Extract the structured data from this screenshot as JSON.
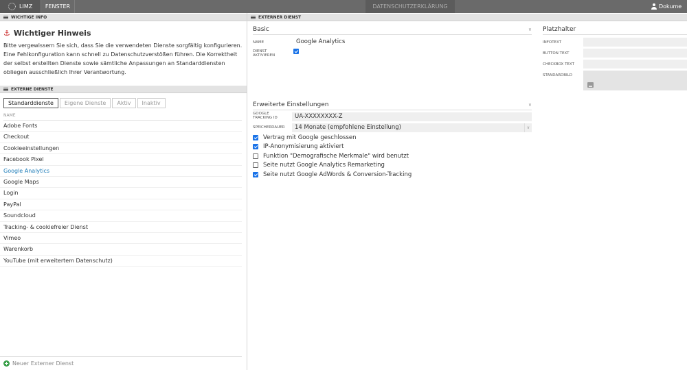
{
  "topbar": {
    "brand": "LIMZ",
    "window_menu": "FENSTER",
    "window_title": "DATENSCHUTZERKLÄRUNG",
    "user": "Dokume"
  },
  "left": {
    "info_header": "WICHTIGE INFO",
    "hint_title": "Wichtiger Hinweis",
    "hint_text": "Bitte vergewissern Sie sich, dass Sie die verwendeten Dienste sorgfältig konfigurieren. Eine Fehlkonfiguration kann schnell zu Datenschutzverstößen führen. Die Korrektheit der selbst erstellten Dienste sowie sämtliche Anpassungen an Standarddiensten obliegen ausschließlich Ihrer Verantwortung.",
    "services_header": "EXTERNE DIENSTE",
    "tabs": [
      "Standarddienste",
      "Eigene Dienste",
      "Aktiv",
      "Inaktiv"
    ],
    "list_header": "NAME",
    "services": [
      "Adobe Fonts",
      "Checkout",
      "Cookieeinstellungen",
      "Facebook Pixel",
      "Google Analytics",
      "Google Maps",
      "Login",
      "PayPal",
      "Soundcloud",
      "Tracking- & cookiefreier Dienst",
      "Vimeo",
      "Warenkorb",
      "YouTube (mit erweitertem Datenschutz)"
    ],
    "selected_service": "Google Analytics",
    "new_service": "Neuer Externer Dienst"
  },
  "right": {
    "header": "EXTERNER DIENST",
    "basic": {
      "title": "Basic",
      "name_label": "NAME",
      "name_value": "Google Analytics",
      "active_label_1": "DIENST",
      "active_label_2": "AKTIVIEREN",
      "active": true
    },
    "advanced": {
      "title": "Erweiterte Einstellungen",
      "tracking_label_1": "GOOGLE",
      "tracking_label_2": "TRACKING ID",
      "tracking_value": "UA-XXXXXXXX-Z",
      "storage_label": "SPEICHERDAUER",
      "storage_value": "14 Monate (empfohlene Einstellung)",
      "options": [
        {
          "label": "Vertrag mit Google geschlossen",
          "checked": true
        },
        {
          "label": "IP-Anonymisierung aktiviert",
          "checked": true
        },
        {
          "label": "Funktion \"Demografische Merkmale\" wird benutzt",
          "checked": false
        },
        {
          "label": "Seite nutzt Google Analytics Remarketing",
          "checked": false
        },
        {
          "label": "Seite nutzt Google AdWords & Conversion-Tracking",
          "checked": true
        }
      ]
    },
    "placeholder": {
      "title": "Platzhalter",
      "infotext_label": "INFOTEXT",
      "button_label": "BUTTON TEXT",
      "checkbox_label": "CHECKBOX TEXT",
      "image_label": "STANDARDBILD"
    }
  },
  "colors": {
    "topbar": "#6a6a6a",
    "selected_link": "#1a7ab7",
    "checkbox_checked": "#1a73e8",
    "warning_icon": "#cc2a2a",
    "add_icon": "#3aa04a"
  }
}
